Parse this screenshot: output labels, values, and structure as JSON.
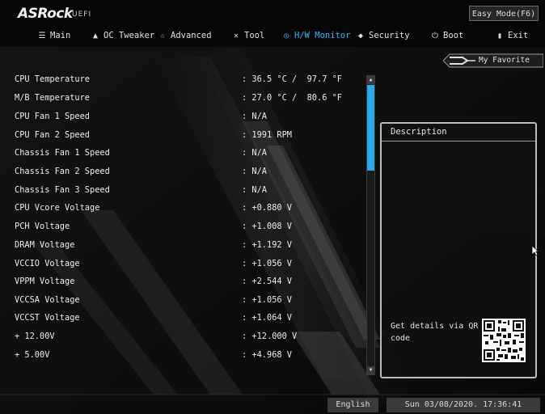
{
  "header": {
    "brand": "ASRock",
    "brand_sub": "UEFI",
    "easy_mode_label": "Easy Mode(F6)"
  },
  "tabs": [
    {
      "label": "Main",
      "icon": "list-icon",
      "active": false
    },
    {
      "label": "OC Tweaker",
      "icon": "rocket-icon",
      "active": false
    },
    {
      "label": "Advanced",
      "icon": "star-icon",
      "active": false
    },
    {
      "label": "Tool",
      "icon": "tool-icon",
      "active": false
    },
    {
      "label": "H/W Monitor",
      "icon": "monitor-icon",
      "active": true
    },
    {
      "label": "Security",
      "icon": "shield-icon",
      "active": false
    },
    {
      "label": "Boot",
      "icon": "power-icon",
      "active": false
    },
    {
      "label": "Exit",
      "icon": "exit-icon",
      "active": false
    }
  ],
  "favorite_label": "My Favorite",
  "monitor_rows": [
    {
      "label": "CPU Temperature",
      "value": ": 36.5 °C /  97.7 °F"
    },
    {
      "label": "M/B Temperature",
      "value": ": 27.0 °C /  80.6 °F"
    },
    {
      "label": "CPU Fan 1 Speed",
      "value": ": N/A"
    },
    {
      "label": "CPU Fan 2 Speed",
      "value": ": 1991 RPM"
    },
    {
      "label": "Chassis Fan 1 Speed",
      "value": ": N/A"
    },
    {
      "label": "Chassis Fan 2 Speed",
      "value": ": N/A"
    },
    {
      "label": "Chassis Fan 3 Speed",
      "value": ": N/A"
    },
    {
      "label": "CPU Vcore Voltage",
      "value": ": +0.880 V"
    },
    {
      "label": "PCH Voltage",
      "value": ": +1.008 V"
    },
    {
      "label": "DRAM Voltage",
      "value": ": +1.192 V"
    },
    {
      "label": "VCCIO Voltage",
      "value": ": +1.056 V"
    },
    {
      "label": "VPPM Voltage",
      "value": ": +2.544 V"
    },
    {
      "label": "VCCSA Voltage",
      "value": ": +1.056 V"
    },
    {
      "label": "VCCST Voltage",
      "value": ": +1.064 V"
    },
    {
      "label": "+ 12.00V",
      "value": ": +12.000 V"
    },
    {
      "label": "+ 5.00V",
      "value": ": +4.968 V"
    }
  ],
  "description": {
    "title": "Description",
    "text": "Get details via QR code"
  },
  "status": {
    "language": "English",
    "datetime": "Sun 03/08/2020. 17:36:41"
  },
  "colors": {
    "accent": "#2fb8ff",
    "scroll_thumb": "#2aa8e8",
    "background": "#0c0c0c"
  }
}
